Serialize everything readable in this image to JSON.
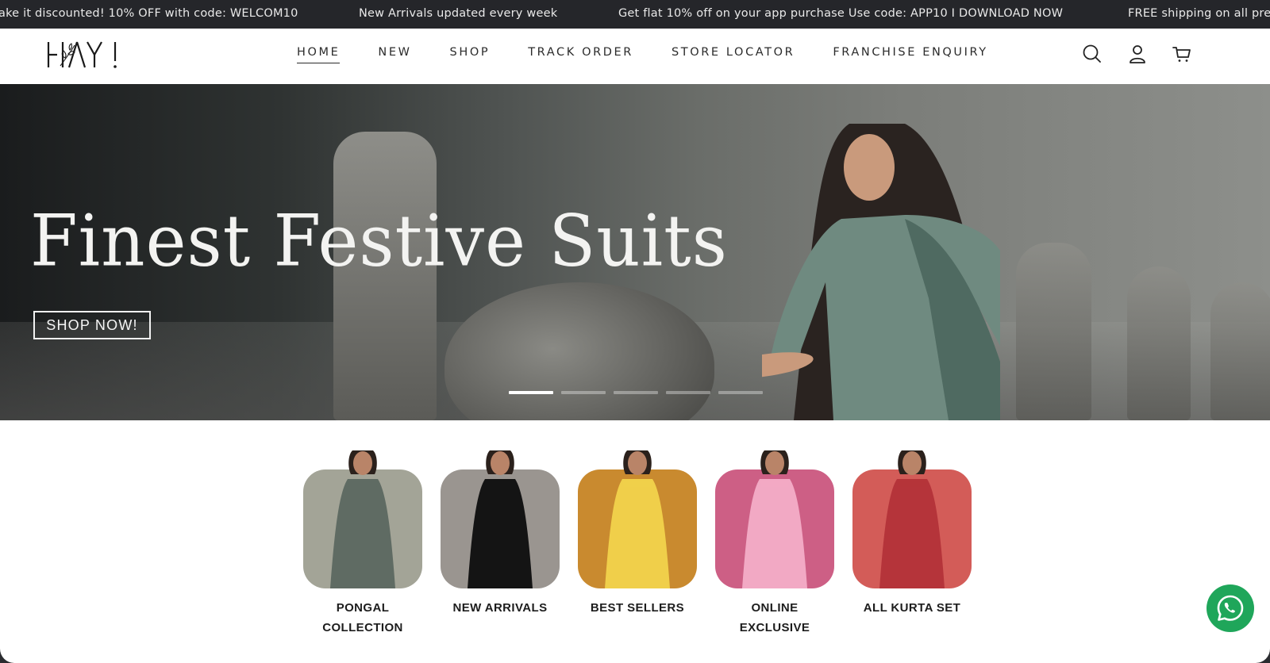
{
  "announcement": {
    "items": [
      "ake it discounted! 10% OFF with code: WELCOM10",
      "New Arrivals updated every week",
      "Get flat 10% off on your app purchase Use code: APP10 I DOWNLOAD NOW",
      "FREE shipping on all pre"
    ]
  },
  "header": {
    "logo_text": "HAY!",
    "nav": [
      {
        "label": "HOME",
        "active": true
      },
      {
        "label": "NEW"
      },
      {
        "label": "SHOP"
      },
      {
        "label": "TRACK ORDER"
      },
      {
        "label": "STORE LOCATOR"
      },
      {
        "label": "FRANCHISE ENQUIRY"
      }
    ],
    "icons": [
      "search-icon",
      "account-icon",
      "cart-icon"
    ]
  },
  "hero": {
    "title": "Finest Festive Suits",
    "cta_label": "SHOP NOW!",
    "slides_total": 5,
    "active_slide": 1
  },
  "categories": [
    {
      "label": "PONGAL COLLECTION",
      "tile_color": "#a3a497",
      "outfit_color": "#5f6b63"
    },
    {
      "label": "NEW ARRIVALS",
      "tile_color": "#9a9590",
      "outfit_color": "#141414"
    },
    {
      "label": "BEST SELLERS",
      "tile_color": "#c98a2f",
      "outfit_color": "#f0cf4a"
    },
    {
      "label": "ONLINE EXCLUSIVE",
      "tile_color": "#cd5f85",
      "outfit_color": "#f2a9c4"
    },
    {
      "label": "ALL KURTA SET",
      "tile_color": "#d35c58",
      "outfit_color": "#b5343a"
    }
  ],
  "colors": {
    "announcement_bg": "#25262a",
    "nav_text": "#2b2b2b",
    "whatsapp": "#1fa65a"
  },
  "widgets": {
    "whatsapp_icon": "whatsapp-icon"
  }
}
